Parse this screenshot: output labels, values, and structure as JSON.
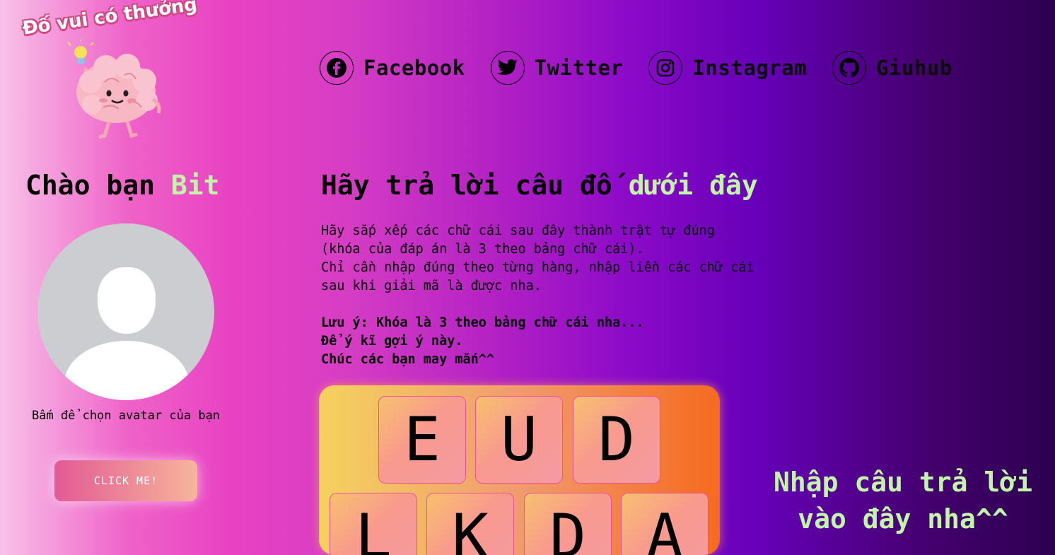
{
  "logo": {
    "title": "Đố vui có thưởng",
    "icon": "brain-mascot-icon"
  },
  "social": [
    {
      "label": "Facebook",
      "icon": "facebook-icon"
    },
    {
      "label": "Twitter",
      "icon": "twitter-icon"
    },
    {
      "label": "Instagram",
      "icon": "instagram-icon"
    },
    {
      "label": "Giuhub",
      "icon": "github-icon"
    }
  ],
  "greeting": {
    "prefix": "Chào bạn ",
    "name": "Bit"
  },
  "avatar": {
    "hint": "Bấm để chọn avatar của bạn",
    "icon": "default-avatar-icon"
  },
  "click_button": {
    "label": "CLICK ME!"
  },
  "main": {
    "heading_prefix": "Hãy trả lời câu đố ",
    "heading_highlight": "dưới đây",
    "instructions": [
      "Hãy sắp xếp các chữ cái sau đây thành trật tự đúng",
      "(khóa của đáp án là 3 theo bảng chữ cái).",
      "Chỉ cần nhập đúng theo từng hàng, nhập liền các chữ cái",
      "sau khi giải mã là được nha."
    ],
    "notes": [
      "Lưu ý: Khóa là 3 theo bảng chữ cái nha...",
      "Để ý kĩ gợi ý này.",
      "Chúc các bạn may mắn^^"
    ]
  },
  "puzzle": {
    "row1": [
      "E",
      "U",
      "D"
    ],
    "row2": [
      "L",
      "K",
      "D",
      "A"
    ]
  },
  "answer_prompt": {
    "line1": "Nhập câu trả lời",
    "line2": "vào đây nha^^"
  },
  "colors": {
    "highlight": "#c3f5a8",
    "button_start": "#e25a95",
    "button_end": "#f7b59b"
  }
}
